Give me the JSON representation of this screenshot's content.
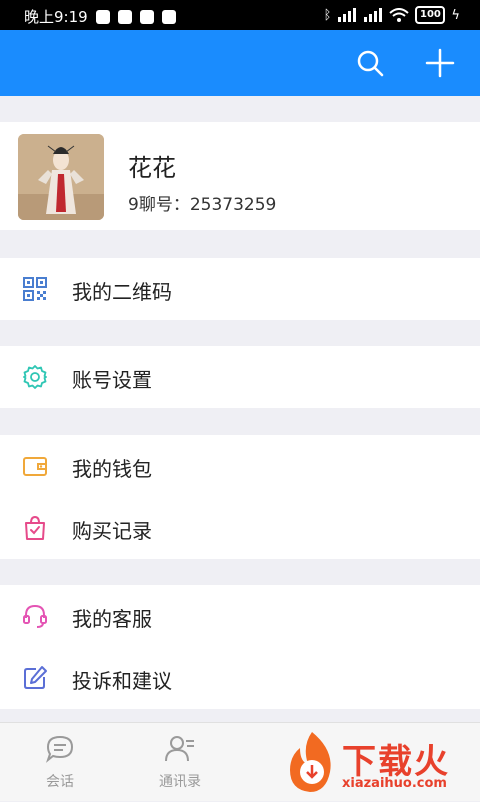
{
  "status_bar": {
    "time": "晚上9:19",
    "battery": "100"
  },
  "header": {
    "search_icon": "search-icon",
    "add_icon": "plus-icon",
    "accent": "#1a8cfe"
  },
  "profile": {
    "name": "花花",
    "id_label": "9聊号：",
    "id_value": "25373259"
  },
  "menu": {
    "qrcode": "我的二维码",
    "account_settings": "账号设置",
    "wallet": "我的钱包",
    "purchases": "购买记录",
    "service": "我的客服",
    "feedback": "投诉和建议"
  },
  "tabs": [
    {
      "label": "会话",
      "icon": "chat-bubble-icon"
    },
    {
      "label": "通讯录",
      "icon": "contacts-icon"
    }
  ],
  "watermark": {
    "title": "下载火",
    "url": "xiazaihuo.com"
  }
}
